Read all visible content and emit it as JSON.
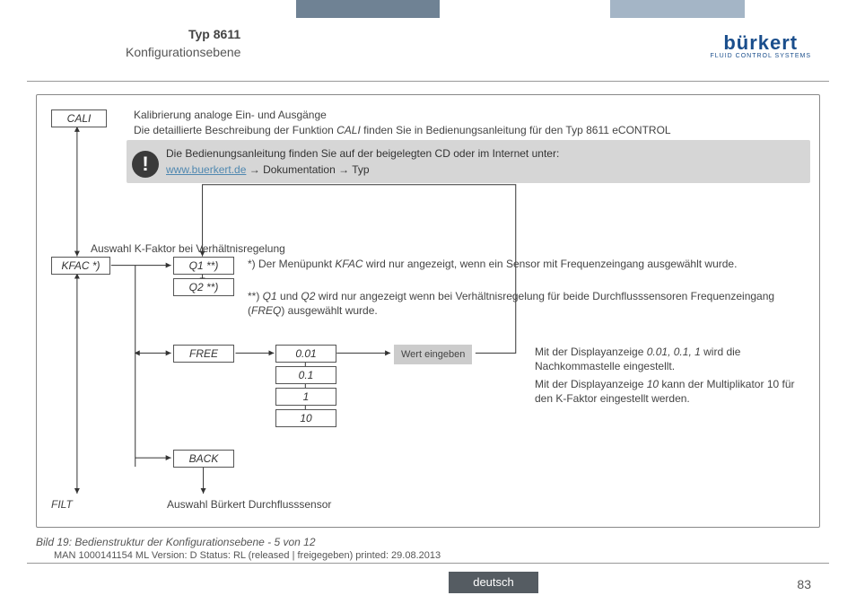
{
  "header": {
    "title": "Typ 8611",
    "subtitle": "Konfigurationsebene",
    "logo_main": "bürkert",
    "logo_sub": "FLUID CONTROL SYSTEMS"
  },
  "cali": {
    "label": "CALI",
    "title": "Kalibrierung analoge Ein- und Ausgänge",
    "desc_a": "Die detaillierte Beschreibung der Funktion ",
    "desc_b": "CALI",
    "desc_c": " finden Sie in Bedienungsanleitung für den Typ 8611 eCONTROL"
  },
  "info": {
    "line1": "Die Bedienungsanleitung finden Sie auf der beigelegten CD oder im Internet unter:",
    "link": "www.buerkert.de",
    "arrow": "→",
    "p1": "Dokumentation",
    "p2": "Typ"
  },
  "kfac": {
    "label": "KFAC *)",
    "q1": "Q1 **)",
    "q2": "Q2 **)",
    "heading": "Auswahl K-Faktor bei Verhältnisregelung",
    "note1_a": "*) Der Menüpunkt ",
    "note1_b": "KFAC",
    "note1_c": " wird nur angezeigt, wenn ein Sensor mit Frequenzeingang ausgewählt wurde.",
    "note2_a": "**) ",
    "note2_b": "Q1",
    "note2_c": " und ",
    "note2_d": "Q2",
    "note2_e": " wird nur angezeigt wenn bei Verhältnisregelung für beide Durchflusssensoren Frequenzeingang (",
    "note2_f": "FREQ",
    "note2_g": ") ausgewählt wurde."
  },
  "free": {
    "label": "FREE",
    "v1": "0.01",
    "v2": "0.1",
    "v3": "1",
    "v4": "10",
    "wert": "Wert eingeben",
    "desc1_a": "Mit der Displayanzeige ",
    "desc1_b": "0.01, 0.1, 1",
    "desc1_c": " wird die Nachkommastelle eingestellt.",
    "desc2_a": "Mit der Displayanzeige ",
    "desc2_b": "10",
    "desc2_c": " kann der Multiplikator 10 für den K-Faktor eingestellt werden."
  },
  "back": {
    "label": "BACK"
  },
  "filt": {
    "label": "FILT",
    "desc": "Auswahl Bürkert Durchflusssensor"
  },
  "caption": "Bild 19:  Bedienstruktur der Konfigurationsebene - 5 von 12",
  "footer": {
    "meta": "MAN  1000141154  ML  Version: D Status: RL (released | freigegeben)  printed: 29.08.2013",
    "lang": "deutsch",
    "page": "83"
  }
}
